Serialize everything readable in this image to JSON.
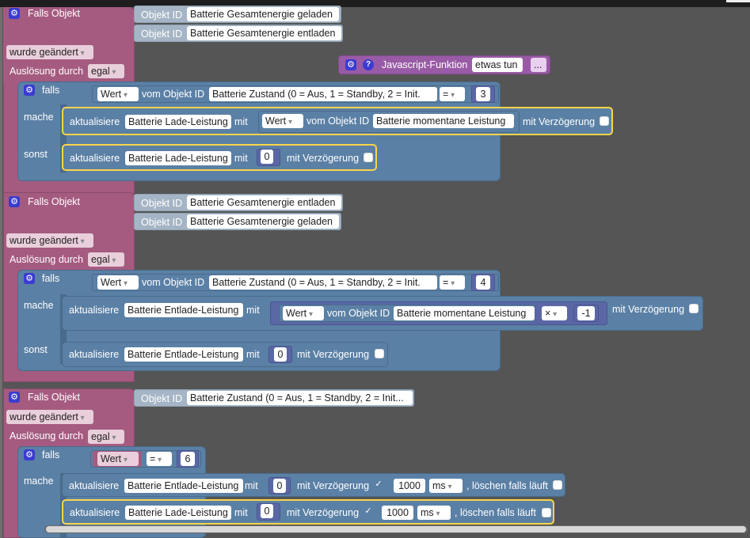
{
  "labels": {
    "falls_objekt": "Falls Objekt",
    "objekt_id": "Objekt ID",
    "wurde_geaendert": "wurde geändert",
    "ausloesung": "Auslösung durch",
    "egal": "egal",
    "falls": "falls",
    "mache": "mache",
    "sonst": "sonst",
    "wert": "Wert",
    "vom_objekt_id": "vom Objekt ID",
    "aktualisiere": "aktualisiere",
    "mit": "mit",
    "mit_verzoegerung": "mit Verzögerung",
    "ms": "ms",
    "loeschen": ", löschen falls läuft",
    "equals": "=",
    "times": "×",
    "js_function": "Javascript-Funktion",
    "etwas_tun": "etwas tun",
    "dots": "...",
    "check": "✓"
  },
  "objects": {
    "gesamt_geladen": "Batterie Gesamtenergie geladen",
    "gesamt_entladen": "Batterie Gesamtenergie entladen",
    "zustand": "Batterie Zustand (0 = Aus, 1 = Standby, 2 = Init...",
    "zustand_trunc": "Batterie Zustand (0 = Aus, 1 = Standby, 2 = Init.",
    "momentane_leistung": "Batterie momentane Leistung",
    "lade_leistung": "Batterie Lade-Leistung",
    "entlade_leistung": "Batterie Entlade-Leistung"
  },
  "values": {
    "three": "3",
    "four": "4",
    "six": "6",
    "zero": "0",
    "minus_one": "-1",
    "delay": "1000"
  },
  "colors": {
    "trigger": "#a55b80",
    "logic": "#5b80a5",
    "math": "#5b67a5",
    "function": "#995ba5",
    "selected": "#fbd54a",
    "workspace": "#555555"
  }
}
